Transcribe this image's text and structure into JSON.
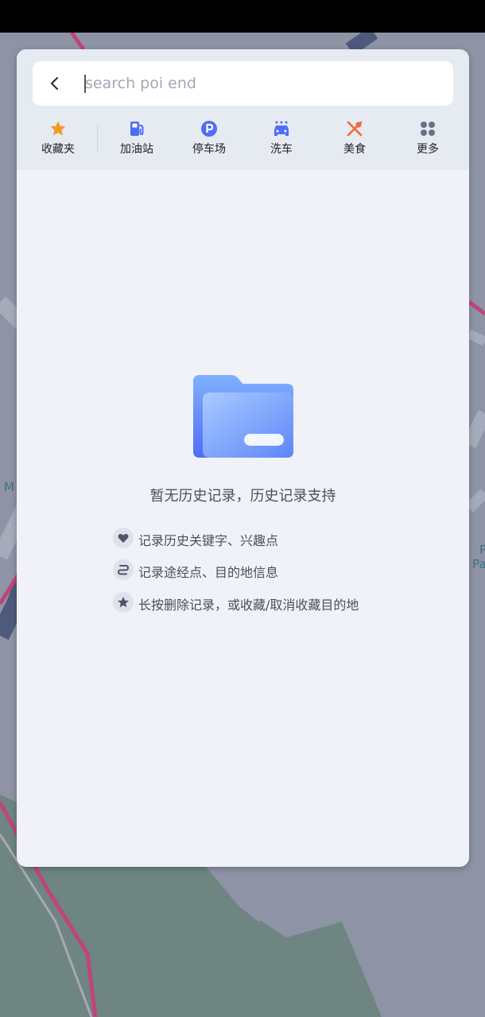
{
  "search": {
    "placeholder": "search poi end",
    "value": ""
  },
  "categories": [
    {
      "label": "收藏夹",
      "icon": "star-icon"
    },
    {
      "label": "加油站",
      "icon": "gas-station-icon"
    },
    {
      "label": "停车场",
      "icon": "parking-icon"
    },
    {
      "label": "洗车",
      "icon": "car-wash-icon"
    },
    {
      "label": "美食",
      "icon": "food-icon"
    },
    {
      "label": "更多",
      "icon": "more-grid-icon"
    }
  ],
  "empty_state": {
    "title": "暂无历史记录，历史记录支持",
    "tips": [
      {
        "icon": "heart-icon",
        "text": "记录历史关键字、兴趣点"
      },
      {
        "icon": "route-icon",
        "text": "记录途经点、目的地信息"
      },
      {
        "icon": "star-icon",
        "text": "长按删除记录，或收藏/取消收藏目的地"
      }
    ]
  },
  "map_labels": {
    "left": "M",
    "right_top": "P",
    "right_bottom": "Pa"
  },
  "colors": {
    "accent_blue": "#4f6ef7",
    "favorite_orange": "#f59a23",
    "food_orange": "#ef6a3a",
    "more_gray": "#6b7183"
  }
}
